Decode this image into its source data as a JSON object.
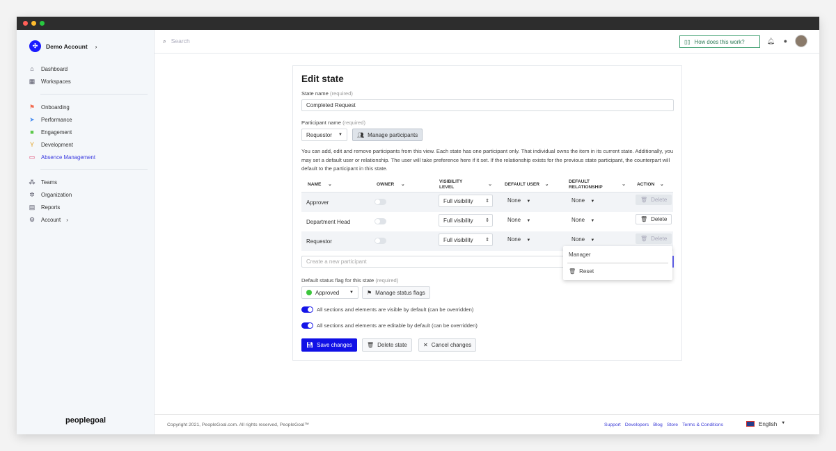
{
  "account": {
    "name": "Demo Account"
  },
  "sidebar": {
    "top": [
      {
        "label": "Dashboard",
        "icon": "home-icon"
      },
      {
        "label": "Workspaces",
        "icon": "grid-icon"
      }
    ],
    "modules": [
      {
        "label": "Onboarding",
        "icon": "flag-icon",
        "color": "#f26b4f"
      },
      {
        "label": "Performance",
        "icon": "paper-plane-icon",
        "color": "#4a8ef0"
      },
      {
        "label": "Engagement",
        "icon": "puzzle-icon",
        "color": "#5cc94a"
      },
      {
        "label": "Development",
        "icon": "sprout-icon",
        "color": "#e0a020"
      },
      {
        "label": "Absence Management",
        "icon": "monitor-icon",
        "color": "#e0406a",
        "active": true
      }
    ],
    "bottom": [
      {
        "label": "Teams",
        "icon": "org-chart-icon"
      },
      {
        "label": "Organization",
        "icon": "network-icon"
      },
      {
        "label": "Reports",
        "icon": "report-icon"
      },
      {
        "label": "Account",
        "icon": "gear-icon"
      }
    ],
    "brand": "peoplegoal"
  },
  "header": {
    "search_placeholder": "Search",
    "help_label": "How does this work?"
  },
  "form": {
    "title": "Edit state",
    "state_name_label": "State name",
    "required": "(required)",
    "state_name_value": "Completed Request",
    "participant_label": "Participant name",
    "participant_value": "Requestor",
    "manage_participants": "Manage participants",
    "help_text": "You can add, edit and remove participants from this view. Each state has one participant only. That individual owns the item in its current state. Additionally, you may set a default user or relationship. The user will take preference here if it set. If the relationship exists for the previous state participant, the counterpart will default to the participant in this state.",
    "columns": [
      "NAME",
      "OWNER",
      "VISIBILITY LEVEL",
      "DEFAULT USER",
      "DEFAULT RELATIONSHIP",
      "ACTION"
    ],
    "rows": [
      {
        "name": "Approver",
        "owner": false,
        "visibility": "Full visibility",
        "user": "None",
        "relationship": "None",
        "action": "Delete",
        "action_enabled": false
      },
      {
        "name": "Department Head",
        "owner": false,
        "visibility": "Full visibility",
        "user": "None",
        "relationship": "None",
        "action": "Delete",
        "action_enabled": true
      },
      {
        "name": "Requestor",
        "owner": false,
        "visibility": "Full visibility",
        "user": "None",
        "relationship": "None",
        "action": "Delete",
        "action_enabled": false
      }
    ],
    "new_participant_placeholder": "Create a new participant",
    "dropdown": {
      "items": [
        "Manager"
      ],
      "reset": "Reset"
    },
    "status_flag_label": "Default status flag for this state",
    "status_value": "Approved",
    "status_color": "#3cc63c",
    "manage_flags": "Manage status flags",
    "toggle_visible": {
      "label": "All sections and elements are visible by default (can be overridden)",
      "on": true
    },
    "toggle_editable": {
      "label": "All sections and elements are editable by default (can be overridden)",
      "on": true
    },
    "save": "Save changes",
    "delete": "Delete state",
    "cancel": "Cancel changes"
  },
  "footer": {
    "copyright": "Copyright 2021, PeopleGoal.com. All rights reserved, PeopleGoal™",
    "links": [
      "Support",
      "Developers",
      "Blog",
      "Store",
      "Terms & Conditions"
    ],
    "language": "English"
  }
}
